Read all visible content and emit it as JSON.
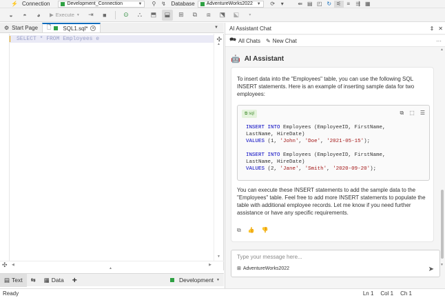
{
  "toolbar": {
    "connection_label": "Connection",
    "connection_value": "Development_Connection",
    "database_label": "Database",
    "database_value": "AdventureWorks2022",
    "execute_label": "Execute"
  },
  "tabs": [
    {
      "label": "Start Page"
    },
    {
      "label": "SQL1.sql*"
    }
  ],
  "editor": {
    "line1": "SELECT * FROM Employees e"
  },
  "editor_bar": {
    "text_label": "Text",
    "data_label": "Data",
    "add_label": "+",
    "connection_label": "Development"
  },
  "status": {
    "ready": "Ready",
    "ln": "Ln 1",
    "col": "Col 1",
    "ch": "Ch 1"
  },
  "chat": {
    "panel_title": "AI Assistant Chat",
    "all_chats": "All Chats",
    "new_chat": "New Chat",
    "assistant_title": "AI Assistant",
    "intro": "To insert data into the \"Employees\" table, you can use the following SQL INSERT statements. Here is an example of inserting sample data for two employees:",
    "code_lang": "sql",
    "code_l1_kw": "INSERT INTO",
    "code_l1_rest": " Employees (EmployeeID, FirstName,",
    "code_l2": "LastName, HireDate)",
    "code_l3_kw": "VALUES",
    "code_l3_a": " (1, ",
    "code_l3_s1": "'John'",
    "code_l3_b": ", ",
    "code_l3_s2": "'Doe'",
    "code_l3_c": ", ",
    "code_l3_s3": "'2021-05-15'",
    "code_l3_d": ");",
    "code_l5_kw": "INSERT INTO",
    "code_l5_rest": " Employees (EmployeeID, FirstName,",
    "code_l6": "LastName, HireDate)",
    "code_l7_kw": "VALUES",
    "code_l7_a": " (2, ",
    "code_l7_s1": "'Jane'",
    "code_l7_b": ", ",
    "code_l7_s2": "'Smith'",
    "code_l7_c": ", ",
    "code_l7_s3": "'2020-09-20'",
    "code_l7_d": ");",
    "outro": "You can execute these INSERT statements to add the sample data to the \"Employees\" table. Feel free to add more INSERT statements to populate the table with additional employee records. Let me know if you need further assistance or have any specific requirements.",
    "input_placeholder": "Type your message here...",
    "context_db": "AdventureWorks2022"
  },
  "colors": {
    "accent": "#0f6cbd",
    "connection_green": "#2ea043"
  }
}
